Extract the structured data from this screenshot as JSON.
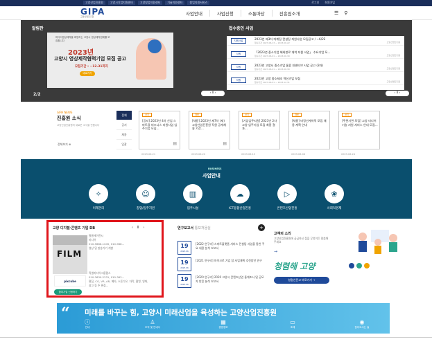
{
  "topbar": {
    "links": [
      "고양산업진흥원",
      "고양시기업지원센터",
      "고양창업지원센터",
      "기술지원센터",
      "창업지원서비스"
    ],
    "right": [
      "로그인",
      "회원가입"
    ]
  },
  "header": {
    "logo": "GIPA",
    "logo_sub": "고양산업진흥원",
    "nav": [
      "사업안내",
      "사업신청",
      "소통마당",
      "진흥원소개"
    ],
    "icons": [
      "menu-icon",
      "search-icon"
    ]
  },
  "hero": {
    "section_title": "알림판",
    "banner": {
      "small": "미디어영상제작을 희망하는 고양시 영상제작업체를 모집합니다",
      "year": "2023년",
      "title": "고양시 영상제작협력기업 모집 공고",
      "period": "모집기간 : ~12.31까지",
      "button": "바로가기"
    },
    "pager": "2/2",
    "pager_controls": "‹ Ⅱ ›"
  },
  "notices": {
    "title": "접수중인 사업",
    "controls": "‹ Ⅱ ›",
    "items": [
      {
        "tag": "지원사업",
        "text": "2023년 제3차 마케팅 컨설팅 지원사업 모집공고 / ~6/22",
        "sub": "접수기간 2023.06.13 ~ 2023.06.22",
        "right": "고양산업진흥원"
      },
      {
        "tag": "지원",
        "text": "「2023년 중소기업 해외판로 개척 지원 사업」 수요기업 모...",
        "sub": "접수기간 2023.06.01 ~ 2023.06.30",
        "right": "고양산업진흥원"
      },
      {
        "tag": "지원",
        "text": "2023년 고양시 중소기업 물류 인센티브 사업 공고 (3차)",
        "sub": "접수기간 2023.06.01 ~ 2023.06.30",
        "right": "고양산업진흥원"
      },
      {
        "tag": "지원",
        "text": "2023년 고양 중소제조 혁신기업 모집",
        "sub": "접수기간 2023.06.01 ~ 2023.12.31",
        "right": "고양산업진흥원"
      }
    ]
  },
  "news": {
    "label": "GIPA NEWS",
    "title": "진흥원 소식",
    "desc": "고양산업진흥원의 새로운 소식을 전합니다",
    "more": "전체보기",
    "tabs": [
      "전체",
      "공지",
      "채용",
      "입찰"
    ],
    "cards": [
      {
        "tag": "공지",
        "text": "[공지] 2023년 4차 산업 스마트융 비즈니스 지원사업 입주기업 모집...",
        "date": "2023.06.21"
      },
      {
        "tag": "채용",
        "text": "[채용] 2023년 제7차 (재) 고양산업진흥원 직원 공개채용 기간...",
        "date": "2023.06.20"
      },
      {
        "tag": "공지",
        "text": "[기업입주지원] 2023년 2차 고양 입주기업 모집 최종 결과...",
        "date": "2023.06.15"
      },
      {
        "tag": "채용",
        "text": "[채용] 비정년계약직 모집 채용 계획 안내",
        "date": "2023.06.06"
      },
      {
        "tag": "공지",
        "text": "[주관기관 모집] 고양 미디어 기술 지원 서비스 안내 모집...",
        "date": "2023.06.24"
      }
    ]
  },
  "business": {
    "en": "BUSINESS",
    "title": "사업안내",
    "items": [
      {
        "label": "이제관리",
        "icon": "lightbulb-icon"
      },
      {
        "label": "창업/입주지원",
        "icon": "people-icon"
      },
      {
        "label": "입주시설",
        "icon": "building-icon"
      },
      {
        "label": "ICT융합산업진흥",
        "icon": "cloud-icon"
      },
      {
        "label": "콘텐츠산업진흥",
        "icon": "play-icon"
      },
      {
        "label": "사회적경제",
        "icon": "handshake-icon"
      }
    ]
  },
  "db": {
    "title": "고양 디지털·콘텐츠 기업 DB",
    "controls": [
      "‹",
      "Ⅱ",
      "›"
    ],
    "film_text": "FILM",
    "company1": [
      "필름에이전시",
      "미디어",
      "010-9686-1045, 010-968...",
      "영상 및 방송기기 개발"
    ],
    "company2_logo": "pixcube",
    "company2": [
      "픽셀미디어그룹랩스",
      "010-3630-2231, 010-363...",
      "편집, CG, VR, AR, 메타, 스튜디오, 자막, 촬영, 영화, 광고 등 주 편집..."
    ],
    "button": "참여기업 신청하기"
  },
  "reports": {
    "title": "연구보고서",
    "title_gray": "통보처용실",
    "items": [
      {
        "day": "19",
        "month": "2023.06",
        "text": "[2022 연구리] 스마트플랫폼 서비스 컨설팅 사업을 통한 주요 내용 분석 보고서"
      },
      {
        "day": "19",
        "month": "2023.06",
        "text": "[2021 연구리] 마이크로 기업 참 사업계획 추진방안 연구"
      },
      {
        "day": "19",
        "month": "2023.06",
        "text": "[2020 연구리] 2020 고양시 콘텐츠산업 통계조사 및 공모자 반응 분석 보고서"
      }
    ]
  },
  "voice": {
    "title": "고객의 소리",
    "desc": "고양산업진흥원에 궁금하신 점을 무엇이든 말씀해주세요",
    "arrow": "→",
    "cleanline": "청렴해 고양",
    "button": "청렴신문고 바로가기 →",
    "dot_colors": [
      "#1f4a9a",
      "#2ca58d",
      "#f0a400"
    ]
  },
  "slogan": {
    "text": "미래를 바꾸는 힘, 고양시 미래산업을 육성하는 고양산업진흥원",
    "links": [
      {
        "label": "안내",
        "icon": "info-icon"
      },
      {
        "label": "조직 및 안내사",
        "icon": "org-icon"
      },
      {
        "label": "경영정보",
        "icon": "chart-icon"
      },
      {
        "label": "조례",
        "icon": "doc-icon"
      },
      {
        "label": "찾아오시는 길",
        "icon": "map-pin-icon"
      }
    ]
  }
}
